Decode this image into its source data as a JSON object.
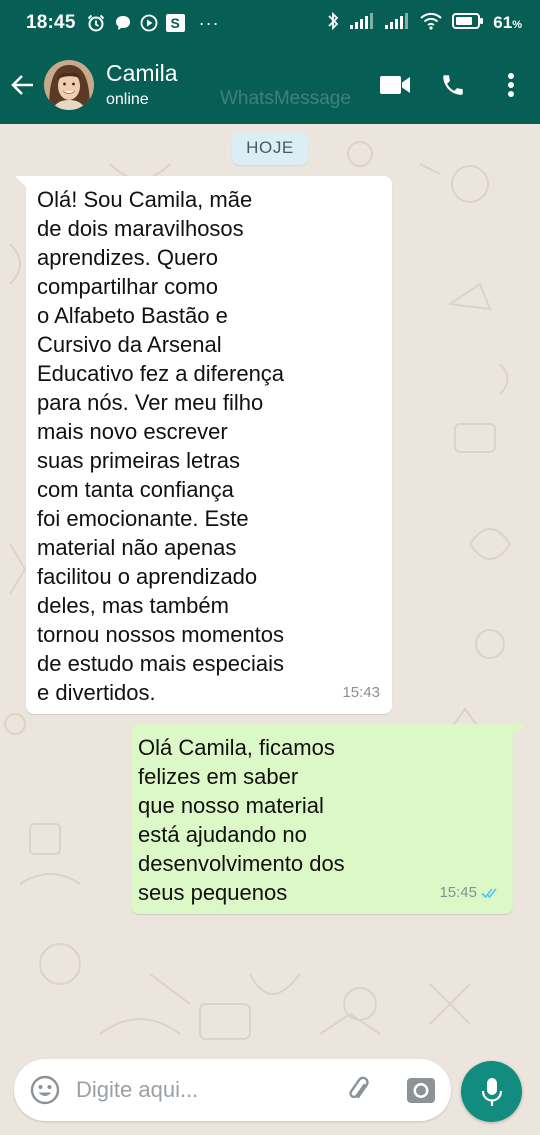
{
  "status_bar": {
    "time": "18:45",
    "battery": "61",
    "battery_unit": "%",
    "more": "···",
    "s_badge": "S",
    "icons": [
      "alarm-icon",
      "chat-bubble-icon",
      "play-icon",
      "s-badge-icon",
      "bluetooth-icon",
      "signal-icon",
      "signal-icon",
      "wifi-icon",
      "battery-icon"
    ]
  },
  "header": {
    "name": "Camila",
    "status": "online",
    "watermark": "WhatsMessage",
    "icons": [
      "back-arrow-icon",
      "video-call-icon",
      "phone-icon",
      "more-vert-icon"
    ]
  },
  "chat": {
    "date_chip": "HOJE",
    "messages": [
      {
        "direction": "incoming",
        "text": "Olá! Sou Camila, mãe\nde dois maravilhosos\naprendizes. Quero\ncompartilhar como\no Alfabeto Bastão e\nCursivo da Arsenal\nEducativo fez a diferença\npara nós. Ver meu filho\nmais novo escrever\nsuas primeiras letras\ncom tanta confiança\nfoi emocionante. Este\nmaterial não apenas\nfacilitou o aprendizado\ndeles, mas também\ntornou nossos momentos\nde estudo mais especiais\ne divertidos.",
        "time": "15:43"
      },
      {
        "direction": "outgoing",
        "text": "Olá Camila, ficamos\nfelizes em saber\nque nosso material\nestá ajudando no\ndesenvolvimento dos\nseus pequenos",
        "time": "15:45",
        "status": "read"
      }
    ]
  },
  "composer": {
    "placeholder": "Digite aqui...",
    "icons": [
      "emoji-icon",
      "attach-icon",
      "camera-icon",
      "mic-icon"
    ]
  },
  "colors": {
    "header_bg": "#075e54",
    "chat_bg": "#ece5dd",
    "incoming_bubble": "#ffffff",
    "outgoing_bubble": "#dcf8c6",
    "mic_button": "#128c7e",
    "read_ticks": "#4fc3f7",
    "date_chip_bg": "#dbeef6"
  }
}
